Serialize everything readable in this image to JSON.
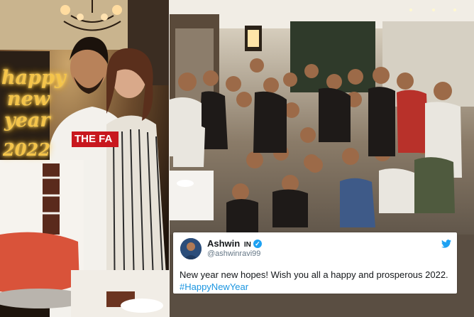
{
  "left_photo": {
    "neon_sign": {
      "line1": "happy",
      "line2": "new",
      "line3": "year",
      "line4": "2022"
    },
    "shirt_text": "THE FA"
  },
  "tweet": {
    "name": "Ashwin",
    "flag": "IN",
    "handle": "@ashwinravi99",
    "verified_icon": "✓",
    "text": "New year new hopes! Wish you all a happy and prosperous 2022.",
    "hashtag": "#HappyNewYear",
    "colors": {
      "link": "#1b95e0",
      "verified": "#1da1f2",
      "text": "#14171a",
      "handle": "#657786"
    }
  }
}
